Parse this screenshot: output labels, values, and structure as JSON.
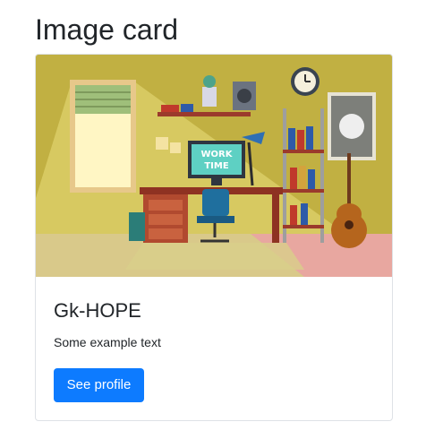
{
  "page": {
    "title": "Image card"
  },
  "card": {
    "image_alt": "Illustration of a cozy room with a desk and computer",
    "image_screen_text": [
      "WORK",
      "TIME"
    ],
    "title": "Gk-HOPE",
    "text": "Some example text",
    "button_label": "See profile"
  },
  "colors": {
    "button": "#0d7bff",
    "border": "#dee2e6",
    "text": "#212529"
  }
}
